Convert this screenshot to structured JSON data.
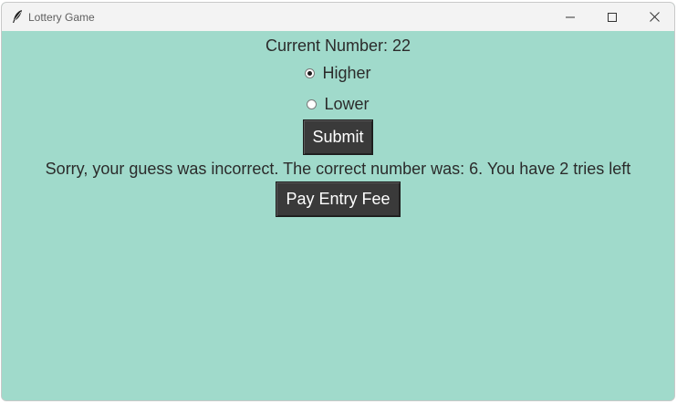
{
  "window": {
    "title": "Lottery Game"
  },
  "game": {
    "current_number_label": "Current Number: 22",
    "options": [
      {
        "label": "Higher",
        "selected": true
      },
      {
        "label": "Lower",
        "selected": false
      }
    ],
    "submit_label": "Submit",
    "result_message": "Sorry, your guess was incorrect. The correct number was: 6. You have 2 tries left",
    "pay_label": "Pay Entry Fee"
  },
  "colors": {
    "background": "#a0dacb",
    "button": "#3a3a3a",
    "button_text": "#ffffff",
    "text": "#2b2b2b"
  },
  "icons": {
    "app": "feather-icon",
    "minimize": "minimize-icon",
    "maximize": "maximize-icon",
    "close": "close-icon"
  }
}
